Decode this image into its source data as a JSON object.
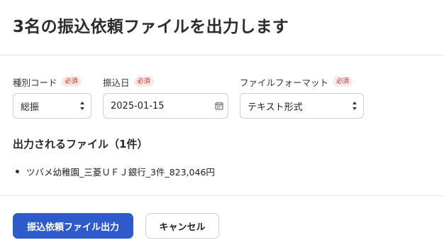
{
  "dialog": {
    "title": "3名の振込依頼ファイルを出力します"
  },
  "form": {
    "required_badge": "必須",
    "type_code": {
      "label": "種別コード",
      "value": "総振"
    },
    "transfer_date": {
      "label": "振込日",
      "value": "2025-01-15"
    },
    "file_format": {
      "label": "ファイルフォーマット",
      "value": "テキスト形式"
    }
  },
  "output": {
    "heading": "出力されるファイル（1件）",
    "files": [
      "ツバメ幼稚園_三菱ＵＦＪ銀行_3件_823,046円"
    ]
  },
  "actions": {
    "submit_label": "振込依頼ファイル出力",
    "cancel_label": "キャンセル"
  },
  "colors": {
    "primary": "#2d5bcc",
    "required_badge_bg": "#fde8e8",
    "required_badge_text": "#c0392b"
  },
  "icons": {
    "select": "chevron-up-down-icon",
    "date": "calendar-icon"
  }
}
